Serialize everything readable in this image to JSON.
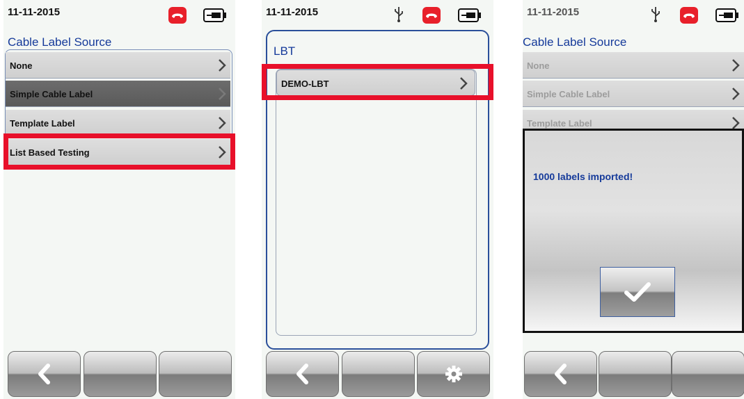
{
  "colors": {
    "accent_blue": "#153a9a",
    "highlight_red": "#e8102a",
    "phone_red": "#e8202a"
  },
  "screens": [
    {
      "date": "11-11-2015",
      "title": "Cable Label Source",
      "items": [
        {
          "label": "None"
        },
        {
          "label": "Simple Cable Label"
        },
        {
          "label": "Template Label"
        },
        {
          "label": "List Based Testing"
        }
      ],
      "selected_item": "Simple Cable Label",
      "highlighted_item": "List Based Testing",
      "icons": [
        "phone-icon",
        "battery-icon"
      ],
      "softkeys": [
        "back-arrow-icon",
        "",
        ""
      ]
    },
    {
      "date": "11-11-2015",
      "title": "LBT",
      "items": [
        {
          "label": "DEMO-LBT"
        }
      ],
      "highlighted_item": "DEMO-LBT",
      "icons": [
        "usb-icon",
        "phone-icon",
        "battery-icon"
      ],
      "softkeys": [
        "back-arrow-icon",
        "",
        "gear-icon"
      ]
    },
    {
      "date": "11-11-2015",
      "title": "Cable Label Source",
      "items": [
        {
          "label": "None"
        },
        {
          "label": "Simple Cable Label"
        },
        {
          "label": "Template Label"
        }
      ],
      "dialog": {
        "message": "1000 labels imported!",
        "button_icon": "checkmark-icon"
      },
      "icons": [
        "usb-icon",
        "phone-icon",
        "battery-icon"
      ],
      "softkeys": [
        "back-arrow-icon",
        "",
        ""
      ]
    }
  ]
}
